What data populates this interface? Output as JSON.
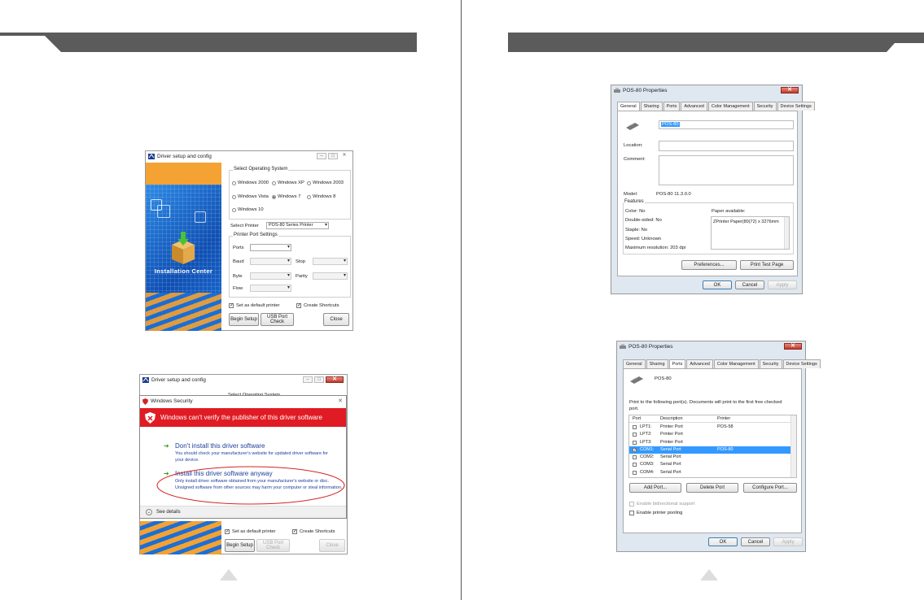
{
  "left_page": {
    "driver_setup": {
      "title": "Driver setup and config",
      "banner_text": "Installation Center",
      "os_group_label": "Select Operating System",
      "os_options": [
        "Windows 2000",
        "Windows XP",
        "Windows 2003",
        "Windows Vista",
        "Windows 7",
        "Windows 8",
        "Windows 10"
      ],
      "os_selected": "Windows 7",
      "select_printer_label": "Select Printer",
      "select_printer_value": "POS-80 Series Printer",
      "port_group_label": "Printer Port Settings",
      "port_label": "Ports",
      "baud_label": "Baud",
      "stop_label": "Stop",
      "byte_label": "Byte",
      "parity_label": "Parity",
      "flow_label": "Flow",
      "default_printer_label": "Set as default printer",
      "create_shortcuts_label": "Create Shortcuts",
      "begin_setup_label": "Begin Setup",
      "usb_port_check_label": "USB Port Check",
      "close_label": "Close"
    },
    "security_dialog": {
      "back_title": "Driver setup and config",
      "back_group_label": "Select Operating System",
      "title": "Windows Security",
      "header": "Windows can't verify the publisher of this driver software",
      "option1_title": "Don't install this driver software",
      "option1_desc": "You should check your manufacturer's website for updated driver software for your device.",
      "option2_title": "Install this driver software anyway",
      "option2_desc": "Only install driver software obtained from your manufacturer's website or disc. Unsigned software from other sources may harm your computer or steal information.",
      "see_details": "See details",
      "default_printer_label": "Set as default printer",
      "create_shortcuts_label": "Create Shortcuts",
      "begin_setup_label": "Begin Setup",
      "usb_port_check_label": "USB Port Check",
      "close_label": "Close"
    }
  },
  "right_page": {
    "general_dialog": {
      "title": "POS-80 Properties",
      "tabs": [
        "General",
        "Sharing",
        "Ports",
        "Advanced",
        "Color Management",
        "Security",
        "Device Settings"
      ],
      "printer_name": "POS-80",
      "location_label": "Location:",
      "comment_label": "Comment:",
      "model_label": "Model:",
      "model_value": "POS-80 11.3.0.0",
      "features_label": "Features",
      "color": "Color: No",
      "double_sided": "Double-sided: No",
      "staple": "Staple: No",
      "speed": "Speed: Unknown",
      "max_resolution": "Maximum resolution: 203 dpi",
      "paper_available_label": "Paper available:",
      "paper_item": "ZPrinter Paper(80(72) x 3276mm",
      "preferences_label": "Preferences...",
      "print_test_label": "Print Test Page",
      "ok_label": "OK",
      "cancel_label": "Cancel",
      "apply_label": "Apply"
    },
    "ports_dialog": {
      "title": "POS-80 Properties",
      "tabs": [
        "General",
        "Sharing",
        "Ports",
        "Advanced",
        "Color Management",
        "Security",
        "Device Settings"
      ],
      "printer_name": "POS-80",
      "instruction": "Print to the following port(s). Documents will print to the first free checked port.",
      "col_port": "Port",
      "col_description": "Description",
      "col_printer": "Printer",
      "rows": [
        {
          "port": "LPT1:",
          "description": "Printer Port",
          "printer": "POS-58",
          "checked": false,
          "selected": false
        },
        {
          "port": "LPT2:",
          "description": "Printer Port",
          "printer": "",
          "checked": false,
          "selected": false
        },
        {
          "port": "LPT3:",
          "description": "Printer Port",
          "printer": "",
          "checked": false,
          "selected": false
        },
        {
          "port": "COM1:",
          "description": "Serial Port",
          "printer": "POS-80",
          "checked": true,
          "selected": true
        },
        {
          "port": "COM2:",
          "description": "Serial Port",
          "printer": "",
          "checked": false,
          "selected": false
        },
        {
          "port": "COM3:",
          "description": "Serial Port",
          "printer": "",
          "checked": false,
          "selected": false
        },
        {
          "port": "COM4:",
          "description": "Serial Port",
          "printer": "",
          "checked": false,
          "selected": false
        }
      ],
      "add_port_label": "Add Port...",
      "delete_port_label": "Delete Port",
      "configure_port_label": "Configure Port...",
      "bidirectional_label": "Enable bidirectional support",
      "pooling_label": "Enable printer pooling",
      "ok_label": "OK",
      "cancel_label": "Cancel",
      "apply_label": "Apply"
    }
  },
  "colors": {
    "header_bar": "#5b5b5b",
    "security_red": "#e01b24",
    "selection_blue": "#3399ff",
    "banner_orange": "#f4a233",
    "banner_blue": "#1d64c4"
  }
}
